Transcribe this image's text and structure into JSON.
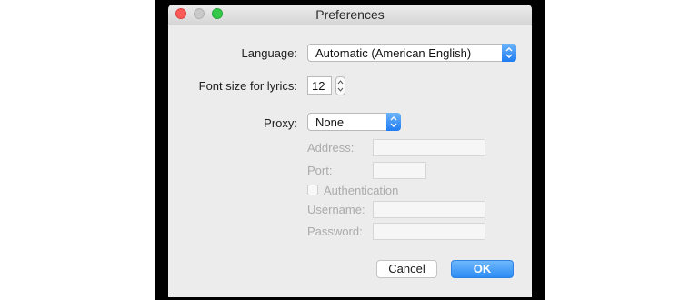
{
  "window": {
    "title": "Preferences"
  },
  "language": {
    "label": "Language:",
    "value": "Automatic (American English)"
  },
  "font_size": {
    "label": "Font size for lyrics:",
    "value": "12"
  },
  "proxy": {
    "label": "Proxy:",
    "value": "None",
    "address_label": "Address:",
    "port_label": "Port:",
    "authentication_label": "Authentication",
    "username_label": "Username:",
    "password_label": "Password:"
  },
  "buttons": {
    "cancel": "Cancel",
    "ok": "OK"
  },
  "colors": {
    "accent": "#2c8cf4",
    "close": "#fc5b57",
    "zoom": "#35c84a"
  }
}
